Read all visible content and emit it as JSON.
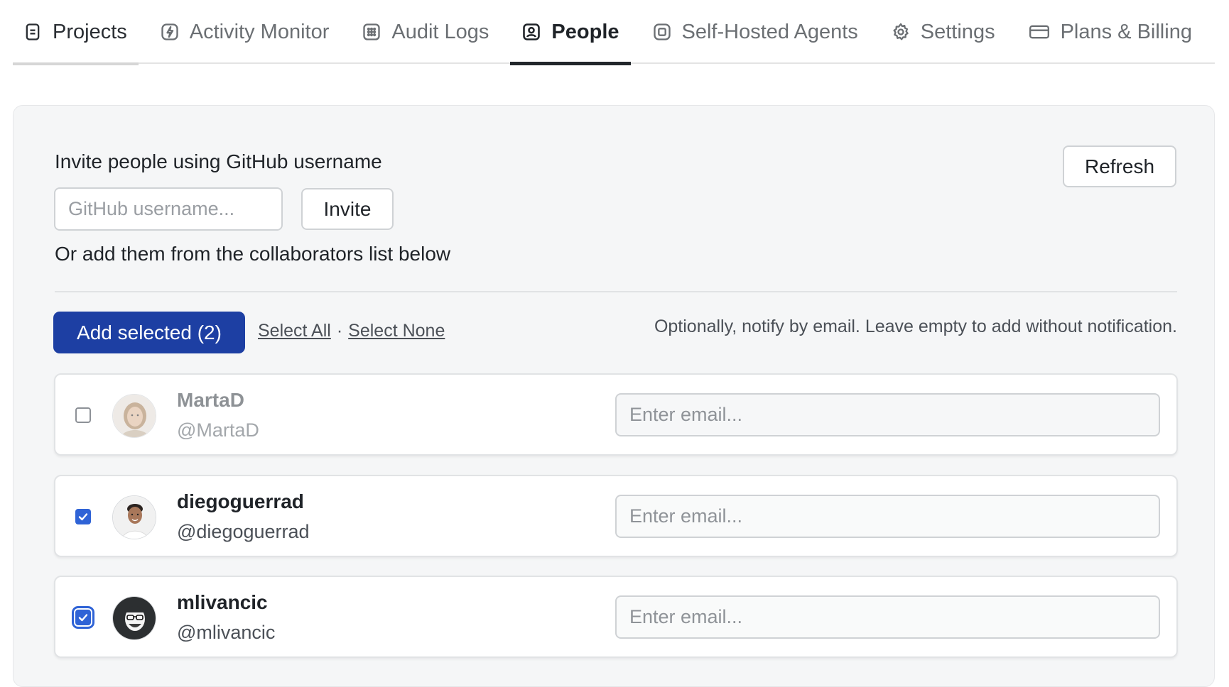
{
  "tabs": [
    {
      "label": "Projects",
      "icon": "document-icon"
    },
    {
      "label": "Activity Monitor",
      "icon": "lightning-icon"
    },
    {
      "label": "Audit Logs",
      "icon": "grid-icon"
    },
    {
      "label": "People",
      "icon": "person-badge-icon",
      "active": true
    },
    {
      "label": "Self-Hosted Agents",
      "icon": "chip-icon"
    },
    {
      "label": "Settings",
      "icon": "gear-icon"
    },
    {
      "label": "Plans & Billing",
      "icon": "credit-card-icon"
    }
  ],
  "invite": {
    "title": "Invite people using GitHub username",
    "input_placeholder": "GitHub username...",
    "invite_label": "Invite",
    "refresh_label": "Refresh",
    "or_text": "Or add them from the collaborators list below"
  },
  "bulk": {
    "add_label": "Add selected (2)",
    "select_all": "Select All",
    "separator": "·",
    "select_none": "Select None",
    "notify_hint": "Optionally, notify by email. Leave empty to add without notification."
  },
  "collaborators": [
    {
      "name": "MartaD",
      "handle": "@MartaD",
      "checked": false,
      "email_placeholder": "Enter email..."
    },
    {
      "name": "diegoguerrad",
      "handle": "@diegoguerrad",
      "checked": true,
      "email_placeholder": "Enter email..."
    },
    {
      "name": "mlivancic",
      "handle": "@mlivancic",
      "checked": true,
      "email_placeholder": "Enter email..."
    }
  ],
  "colors": {
    "primary": "#1d3fa3",
    "checkbox": "#2f63d6",
    "active_underline": "#22272b"
  }
}
